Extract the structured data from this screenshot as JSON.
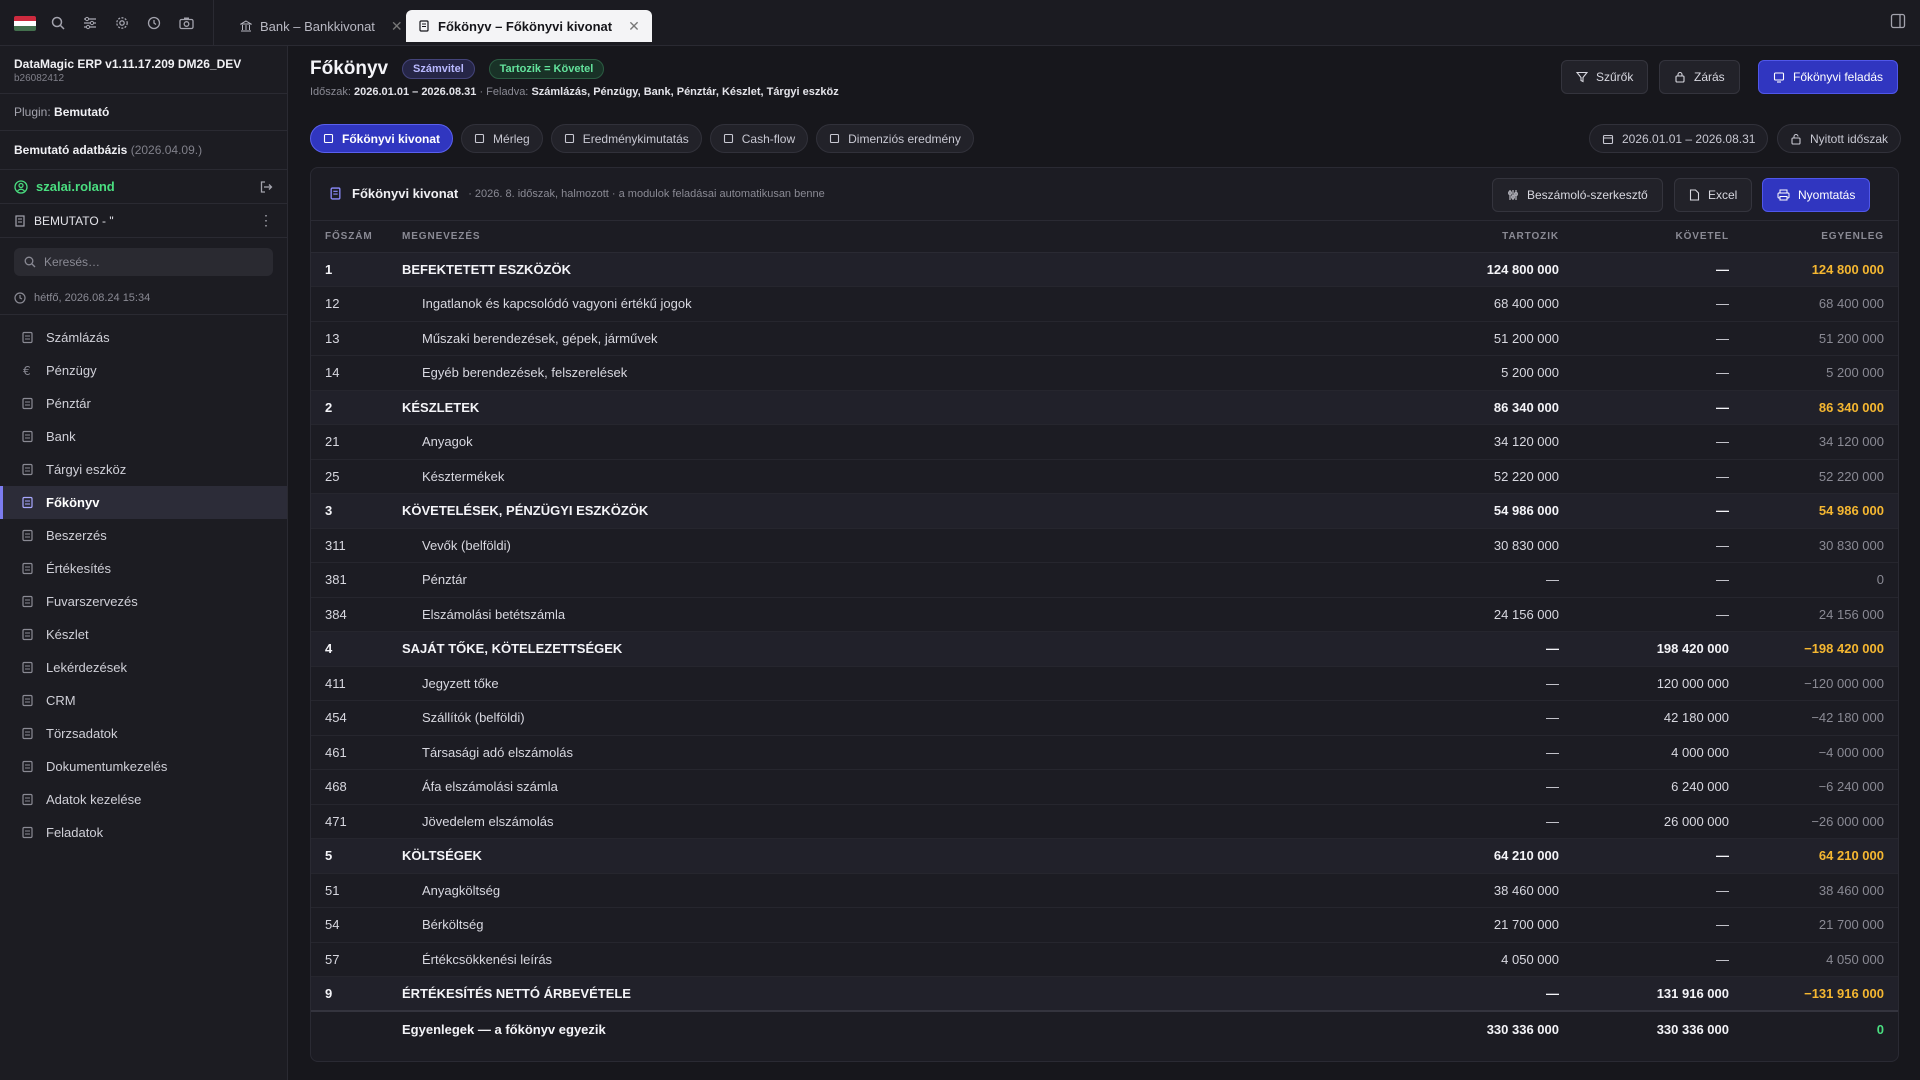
{
  "topbar": {
    "tabs": [
      {
        "label": "Bank – Bankkivonat",
        "active": false
      },
      {
        "label": "Főkönyv – Főkönyvi kivonat",
        "active": true
      }
    ],
    "close_glyph": "✕"
  },
  "sidebar": {
    "app_title": "DataMagic ERP v1.11.17.209 DM26_DEV",
    "build": "b26082412",
    "plugin_label": "Plugin:",
    "plugin_value": "Bemutató",
    "db_name": "Bemutató adatbázis",
    "db_date": "(2026.04.09.)",
    "user": "szalai.roland",
    "company": "BEMUTATO - \"",
    "search_placeholder": "Keresés…",
    "datetime": "hétfő, 2026.08.24 15:34",
    "nav": [
      {
        "label": "Számlázás",
        "icon": "invoice-icon"
      },
      {
        "label": "Pénzügy",
        "icon": "euro-icon"
      },
      {
        "label": "Pénztár",
        "icon": "cash-register-icon"
      },
      {
        "label": "Bank",
        "icon": "bank-icon"
      },
      {
        "label": "Tárgyi eszköz",
        "icon": "asset-icon"
      },
      {
        "label": "Főkönyv",
        "icon": "ledger-icon",
        "active": true
      },
      {
        "label": "Beszerzés",
        "icon": "cart-icon"
      },
      {
        "label": "Értékesítés",
        "icon": "sales-icon"
      },
      {
        "label": "Fuvarszervezés",
        "icon": "truck-icon"
      },
      {
        "label": "Készlet",
        "icon": "boxes-icon"
      },
      {
        "label": "Lekérdezések",
        "icon": "chart-icon"
      },
      {
        "label": "CRM",
        "icon": "crm-icon"
      },
      {
        "label": "Törzsadatok",
        "icon": "database-icon"
      },
      {
        "label": "Dokumentumkezelés",
        "icon": "folder-icon"
      },
      {
        "label": "Adatok kezelése",
        "icon": "gear-icon"
      },
      {
        "label": "Feladatok",
        "icon": "tasks-icon"
      }
    ]
  },
  "header": {
    "title": "Főkönyv",
    "badge1": "Számvitel",
    "badge2": "Tartozik = Követel",
    "period_label": "Időszak:",
    "period_value": "2026.01.01 – 2026.08.31",
    "sep": "·",
    "sender_label": "Feladva:",
    "sender_value": "Számlázás, Pénzügy, Bank, Pénztár, Készlet, Tárgyi eszköz",
    "btn_filters": "Szűrők",
    "btn_close": "Zárás",
    "btn_post": "Főkönyvi feladás"
  },
  "subtabs": [
    {
      "label": "Főkönyvi kivonat",
      "active": true
    },
    {
      "label": "Mérleg"
    },
    {
      "label": "Eredménykimutatás"
    },
    {
      "label": "Cash-flow"
    },
    {
      "label": "Dimenziós eredmény"
    }
  ],
  "period_pill": "2026.01.01 – 2026.08.31",
  "open_period_pill": "Nyitott időszak",
  "card": {
    "title": "Főkönyvi kivonat",
    "subtitle": "· 2026. 8. időszak, halmozott · a modulok feladásai automatikusan benne",
    "btn_report": "Beszámoló-szerkesztő",
    "btn_excel": "Excel",
    "btn_print": "Nyomtatás"
  },
  "table": {
    "headers": [
      "FŐSZÁM",
      "MEGNEVEZÉS",
      "TARTOZIK",
      "KÖVETEL",
      "EGYENLEG"
    ],
    "rows": [
      {
        "type": "group",
        "code": "1",
        "name": "BEFEKTETETT ESZKÖZÖK",
        "debit": "124 800 000",
        "credit": "—",
        "balance": "124 800 000"
      },
      {
        "type": "child",
        "code": "12",
        "name": "Ingatlanok és kapcsolódó vagyoni értékű jogok",
        "debit": "68 400 000",
        "credit": "—",
        "balance": "68 400 000"
      },
      {
        "type": "child",
        "code": "13",
        "name": "Műszaki berendezések, gépek, járművek",
        "debit": "51 200 000",
        "credit": "—",
        "balance": "51 200 000"
      },
      {
        "type": "child",
        "code": "14",
        "name": "Egyéb berendezések, felszerelések",
        "debit": "5 200 000",
        "credit": "—",
        "balance": "5 200 000"
      },
      {
        "type": "group",
        "code": "2",
        "name": "KÉSZLETEK",
        "debit": "86 340 000",
        "credit": "—",
        "balance": "86 340 000"
      },
      {
        "type": "child",
        "code": "21",
        "name": "Anyagok",
        "debit": "34 120 000",
        "credit": "—",
        "balance": "34 120 000"
      },
      {
        "type": "child",
        "code": "25",
        "name": "Késztermékek",
        "debit": "52 220 000",
        "credit": "—",
        "balance": "52 220 000"
      },
      {
        "type": "group",
        "code": "3",
        "name": "KÖVETELÉSEK, PÉNZÜGYI ESZKÖZÖK",
        "debit": "54 986 000",
        "credit": "—",
        "balance": "54 986 000"
      },
      {
        "type": "child",
        "code": "311",
        "name": "Vevők (belföldi)",
        "debit": "30 830 000",
        "credit": "—",
        "balance": "30 830 000"
      },
      {
        "type": "child",
        "code": "381",
        "name": "Pénztár",
        "debit": "—",
        "credit": "—",
        "balance": "0"
      },
      {
        "type": "child",
        "code": "384",
        "name": "Elszámolási betétszámla",
        "debit": "24 156 000",
        "credit": "—",
        "balance": "24 156 000"
      },
      {
        "type": "group",
        "code": "4",
        "name": "SAJÁT TŐKE, KÖTELEZETTSÉGEK",
        "debit": "—",
        "credit": "198 420 000",
        "balance": "−198 420 000"
      },
      {
        "type": "child",
        "code": "411",
        "name": "Jegyzett tőke",
        "debit": "—",
        "credit": "120 000 000",
        "balance": "−120 000 000"
      },
      {
        "type": "child",
        "code": "454",
        "name": "Szállítók (belföldi)",
        "debit": "—",
        "credit": "42 180 000",
        "balance": "−42 180 000"
      },
      {
        "type": "child",
        "code": "461",
        "name": "Társasági adó elszámolás",
        "debit": "—",
        "credit": "4 000 000",
        "balance": "−4 000 000"
      },
      {
        "type": "child",
        "code": "468",
        "name": "Áfa elszámolási számla",
        "debit": "—",
        "credit": "6 240 000",
        "balance": "−6 240 000"
      },
      {
        "type": "child",
        "code": "471",
        "name": "Jövedelem elszámolás",
        "debit": "—",
        "credit": "26 000 000",
        "balance": "−26 000 000"
      },
      {
        "type": "group",
        "code": "5",
        "name": "KÖLTSÉGEK",
        "debit": "64 210 000",
        "credit": "—",
        "balance": "64 210 000"
      },
      {
        "type": "child",
        "code": "51",
        "name": "Anyagköltség",
        "debit": "38 460 000",
        "credit": "—",
        "balance": "38 460 000"
      },
      {
        "type": "child",
        "code": "54",
        "name": "Bérköltség",
        "debit": "21 700 000",
        "credit": "—",
        "balance": "21 700 000"
      },
      {
        "type": "child",
        "code": "57",
        "name": "Értékcsökkenési leírás",
        "debit": "4 050 000",
        "credit": "—",
        "balance": "4 050 000"
      },
      {
        "type": "group",
        "code": "9",
        "name": "ÉRTÉKESÍTÉS NETTÓ ÁRBEVÉTELE",
        "debit": "—",
        "credit": "131 916 000",
        "balance": "−131 916 000"
      }
    ],
    "total": {
      "name": "Egyenlegek — a főkönyv egyezik",
      "debit": "330 336 000",
      "credit": "330 336 000",
      "balance": "0"
    }
  },
  "colors": {
    "accent": "#3036c0",
    "positive": "#4ade80",
    "group_balance": "#f5b731"
  }
}
